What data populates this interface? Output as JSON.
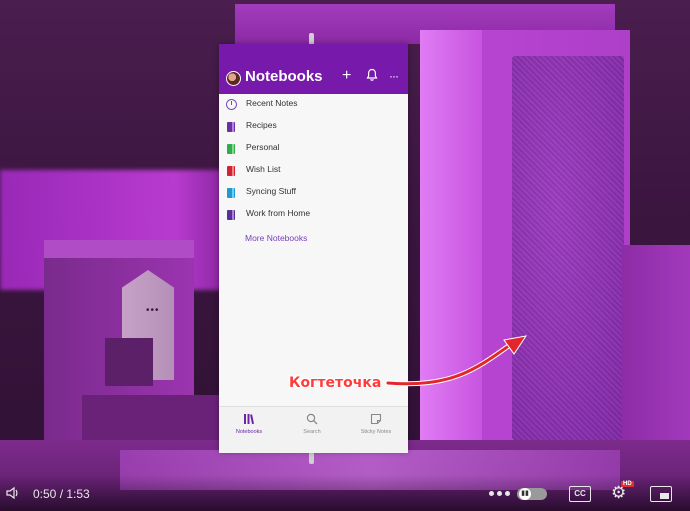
{
  "app": {
    "title": "Notebooks",
    "header_icons": [
      "avatar-icon",
      "plus-icon",
      "bell-icon",
      "more-icon"
    ],
    "plus_glyph": "+",
    "more_glyph": "···",
    "list": [
      {
        "label": "Recent Notes",
        "icon": "clock-icon",
        "color": "#7a4fb0"
      },
      {
        "label": "Recipes",
        "icon": "notebook-icon",
        "color": "#6a2fa8"
      },
      {
        "label": "Personal",
        "icon": "notebook-icon",
        "color": "#2eae47"
      },
      {
        "label": "Wish List",
        "icon": "notebook-icon",
        "color": "#d4232f"
      },
      {
        "label": "Syncing Stuff",
        "icon": "notebook-icon",
        "color": "#1a9ad6"
      },
      {
        "label": "Work from Home",
        "icon": "notebook-icon",
        "color": "#5a2d9a"
      }
    ],
    "more_notebooks": "More Notebooks",
    "tabs": [
      {
        "label": "Notebooks",
        "icon": "notebooks-icon",
        "active": true
      },
      {
        "label": "Search",
        "icon": "search-icon",
        "active": false
      },
      {
        "label": "Sticky Notes",
        "icon": "sticky-notes-icon",
        "active": false
      }
    ]
  },
  "annotation": {
    "text": "Когтеточка",
    "color": "#ff3b3b"
  },
  "player": {
    "time": "0:50 / 1:53",
    "cc_label": "CC",
    "hd_badge": "HD",
    "autoplay_state": "paused"
  },
  "colors": {
    "accent": "#7719aa",
    "scene_purple": "#b845d3"
  }
}
